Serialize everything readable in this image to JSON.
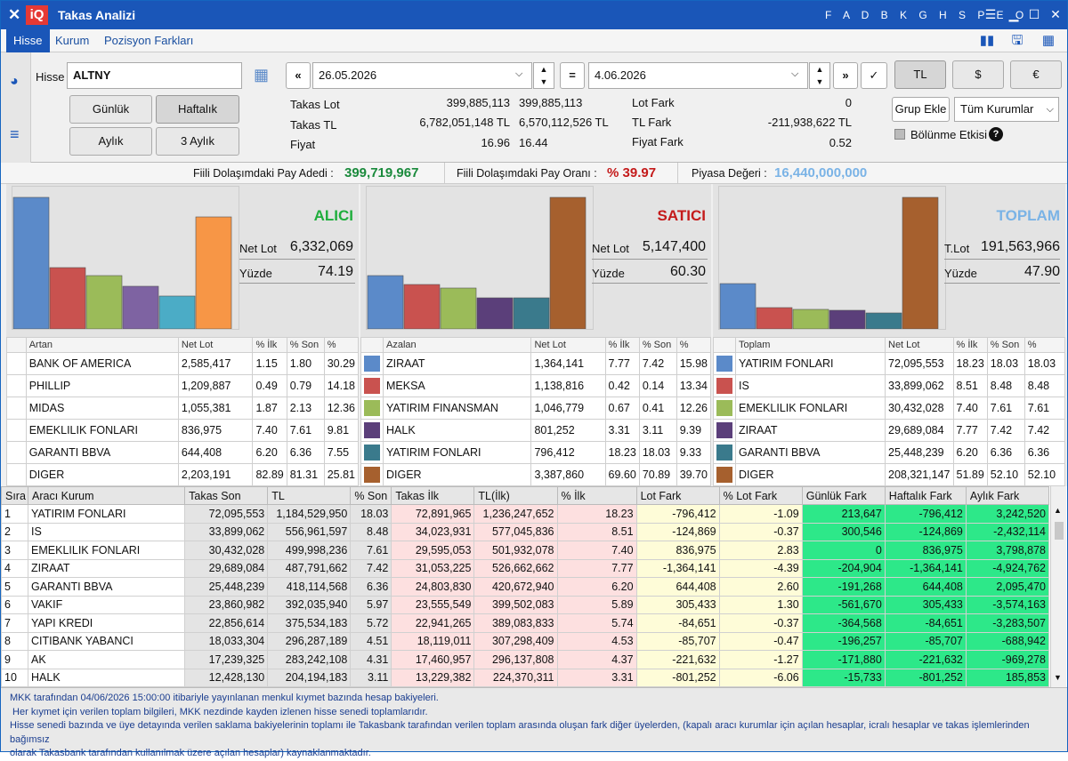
{
  "window": {
    "title": "Takas Analizi",
    "letter_menu": "F A D B K G H S P E O"
  },
  "tabs": [
    {
      "label": "Hisse"
    },
    {
      "label": "Kurum"
    },
    {
      "label": "Pozisyon Farkları"
    }
  ],
  "controls": {
    "hisse_label": "Hisse",
    "hisse_value": "ALTNY",
    "date_from": "26.05.2026",
    "date_to": "4.06.2026",
    "period_buttons": [
      "Günlük",
      "Haftalık",
      "Aylık",
      "3 Aylık"
    ],
    "currency_buttons": [
      "TL",
      "$",
      "€"
    ],
    "grup_ekle": "Grup Ekle",
    "kurum_select": "Tüm Kurumlar",
    "bolunme_label": "Bölünme Etkisi",
    "bolunme_checked": false
  },
  "summary": {
    "takas_lot": {
      "label": "Takas Lot",
      "v1": "399,885,113",
      "v2": "399,885,113"
    },
    "takas_tl": {
      "label": "Takas TL",
      "v1": "6,782,051,148 TL",
      "v2": "6,570,112,526 TL"
    },
    "fiyat": {
      "label": "Fiyat",
      "v1": "16.96",
      "v2": "16.44"
    },
    "lot_fark": {
      "label": "Lot Fark",
      "value": "0"
    },
    "tl_fark": {
      "label": "TL Fark",
      "value": "-211,938,622 TL"
    },
    "fiyat_fark": {
      "label": "Fiyat Fark",
      "value": "0.52"
    }
  },
  "stats": {
    "pay_adedi_label": "Fiili Dolaşımdaki Pay Adedi :",
    "pay_adedi": "399,719,967",
    "pay_orani_label": "Fiili Dolaşımdaki Pay Oranı :",
    "pay_orani": "% 39.97",
    "piyasa_label": "Piyasa Değeri :",
    "piyasa": "16,440,000,000"
  },
  "colors": {
    "blue": "#5b8ac9",
    "red": "#c9524f",
    "green": "#9bbb59",
    "purple": "#7e63a2",
    "teal": "#4bacc6",
    "orange": "#f79646",
    "brown": "#a6602e",
    "dteal": "#3a7a8c",
    "dpurple": "#5b3f7a",
    "alici": "#1fae3c",
    "satici": "#c41a1a",
    "toplam": "#7ab3e6"
  },
  "panels": [
    {
      "title": "ALICI",
      "k1": "Net Lot",
      "v1": "6,332,069",
      "k2": "Yüzde",
      "v2": "74.19",
      "chart_data": {
        "type": "bar",
        "values": [
          2585417,
          1209887,
          1055381,
          836975,
          644408,
          2203191
        ],
        "colors": [
          "#5b8ac9",
          "#c9524f",
          "#9bbb59",
          "#7e63a2",
          "#4bacc6",
          "#f79646"
        ]
      },
      "header": [
        "Artan",
        "Net Lot",
        "% İlk",
        "% Son",
        "%"
      ],
      "rows": [
        {
          "swatch": "",
          "name": "BANK OF AMERICA",
          "net": "2,585,417",
          "ilk": "1.15",
          "son": "1.80",
          "pct": "30.29"
        },
        {
          "swatch": "",
          "name": "PHILLIP",
          "net": "1,209,887",
          "ilk": "0.49",
          "son": "0.79",
          "pct": "14.18"
        },
        {
          "swatch": "",
          "name": "MIDAS",
          "net": "1,055,381",
          "ilk": "1.87",
          "son": "2.13",
          "pct": "12.36"
        },
        {
          "swatch": "",
          "name": "EMEKLILIK FONLARI",
          "net": "836,975",
          "ilk": "7.40",
          "son": "7.61",
          "pct": "9.81"
        },
        {
          "swatch": "",
          "name": "GARANTI BBVA",
          "net": "644,408",
          "ilk": "6.20",
          "son": "6.36",
          "pct": "7.55"
        },
        {
          "swatch": "",
          "name": "DIGER",
          "net": "2,203,191",
          "ilk": "82.89",
          "son": "81.31",
          "pct": "25.81"
        }
      ]
    },
    {
      "title": "SATICI",
      "k1": "Net Lot",
      "v1": "5,147,400",
      "k2": "Yüzde",
      "v2": "60.30",
      "chart_data": {
        "type": "bar",
        "values": [
          1364141,
          1138816,
          1046779,
          801252,
          796412,
          3387860
        ],
        "colors": [
          "#5b8ac9",
          "#c9524f",
          "#9bbb59",
          "#5b3f7a",
          "#3a7a8c",
          "#a6602e"
        ]
      },
      "header": [
        "Azalan",
        "Net Lot",
        "% İlk",
        "% Son",
        "%"
      ],
      "rows": [
        {
          "swatch": "#5b8ac9",
          "name": "ZIRAAT",
          "net": "1,364,141",
          "ilk": "7.77",
          "son": "7.42",
          "pct": "15.98"
        },
        {
          "swatch": "#c9524f",
          "name": "MEKSA",
          "net": "1,138,816",
          "ilk": "0.42",
          "son": "0.14",
          "pct": "13.34"
        },
        {
          "swatch": "#9bbb59",
          "name": "YATIRIM FINANSMAN",
          "net": "1,046,779",
          "ilk": "0.67",
          "son": "0.41",
          "pct": "12.26"
        },
        {
          "swatch": "#5b3f7a",
          "name": "HALK",
          "net": "801,252",
          "ilk": "3.31",
          "son": "3.11",
          "pct": "9.39"
        },
        {
          "swatch": "#3a7a8c",
          "name": "YATIRIM FONLARI",
          "net": "796,412",
          "ilk": "18.23",
          "son": "18.03",
          "pct": "9.33"
        },
        {
          "swatch": "#a6602e",
          "name": "DIGER",
          "net": "3,387,860",
          "ilk": "69.60",
          "son": "70.89",
          "pct": "39.70"
        }
      ]
    },
    {
      "title": "TOPLAM",
      "k1": "T.Lot",
      "v1": "191,563,966",
      "k2": "Yüzde",
      "v2": "47.90",
      "chart_data": {
        "type": "bar",
        "values": [
          72095553,
          33899062,
          30432028,
          29689084,
          25448239,
          208321147
        ],
        "colors": [
          "#5b8ac9",
          "#c9524f",
          "#9bbb59",
          "#5b3f7a",
          "#3a7a8c",
          "#a6602e"
        ]
      },
      "header": [
        "Toplam",
        "Net Lot",
        "% İlk",
        "% Son",
        "%"
      ],
      "rows": [
        {
          "swatch": "#5b8ac9",
          "name": "YATIRIM FONLARI",
          "net": "72,095,553",
          "ilk": "18.23",
          "son": "18.03",
          "pct": "18.03"
        },
        {
          "swatch": "#c9524f",
          "name": "IS",
          "net": "33,899,062",
          "ilk": "8.51",
          "son": "8.48",
          "pct": "8.48"
        },
        {
          "swatch": "#9bbb59",
          "name": "EMEKLILIK FONLARI",
          "net": "30,432,028",
          "ilk": "7.40",
          "son": "7.61",
          "pct": "7.61"
        },
        {
          "swatch": "#5b3f7a",
          "name": "ZIRAAT",
          "net": "29,689,084",
          "ilk": "7.77",
          "son": "7.42",
          "pct": "7.42"
        },
        {
          "swatch": "#3a7a8c",
          "name": "GARANTI BBVA",
          "net": "25,448,239",
          "ilk": "6.20",
          "son": "6.36",
          "pct": "6.36"
        },
        {
          "swatch": "#a6602e",
          "name": "DIGER",
          "net": "208,321,147",
          "ilk": "51.89",
          "son": "52.10",
          "pct": "52.10"
        }
      ]
    }
  ],
  "main_table": {
    "headers": [
      "Sıra",
      "Aracı Kurum",
      "Takas Son",
      "TL",
      "% Son",
      "Takas İlk",
      "TL(İlk)",
      "% İlk",
      "Lot Fark",
      "% Lot Fark",
      "Günlük Fark",
      "Haftalık Fark",
      "Aylık Fark"
    ],
    "rows": [
      [
        "1",
        "YATIRIM FONLARI",
        "72,095,553",
        "1,184,529,950",
        "18.03",
        "72,891,965",
        "1,236,247,652",
        "18.23",
        "-796,412",
        "-1.09",
        "213,647",
        "-796,412",
        "3,242,520"
      ],
      [
        "2",
        "IS",
        "33,899,062",
        "556,961,597",
        "8.48",
        "34,023,931",
        "577,045,836",
        "8.51",
        "-124,869",
        "-0.37",
        "300,546",
        "-124,869",
        "-2,432,114"
      ],
      [
        "3",
        "EMEKLILIK FONLARI",
        "30,432,028",
        "499,998,236",
        "7.61",
        "29,595,053",
        "501,932,078",
        "7.40",
        "836,975",
        "2.83",
        "0",
        "836,975",
        "3,798,878"
      ],
      [
        "4",
        "ZIRAAT",
        "29,689,084",
        "487,791,662",
        "7.42",
        "31,053,225",
        "526,662,662",
        "7.77",
        "-1,364,141",
        "-4.39",
        "-204,904",
        "-1,364,141",
        "-4,924,762"
      ],
      [
        "5",
        "GARANTI BBVA",
        "25,448,239",
        "418,114,568",
        "6.36",
        "24,803,830",
        "420,672,940",
        "6.20",
        "644,408",
        "2.60",
        "-191,268",
        "644,408",
        "2,095,470"
      ],
      [
        "6",
        "VAKIF",
        "23,860,982",
        "392,035,940",
        "5.97",
        "23,555,549",
        "399,502,083",
        "5.89",
        "305,433",
        "1.30",
        "-561,670",
        "305,433",
        "-3,574,163"
      ],
      [
        "7",
        "YAPI KREDI",
        "22,856,614",
        "375,534,183",
        "5.72",
        "22,941,265",
        "389,083,833",
        "5.74",
        "-84,651",
        "-0.37",
        "-364,568",
        "-84,651",
        "-3,283,507"
      ],
      [
        "8",
        "CITIBANK YABANCI",
        "18,033,304",
        "296,287,189",
        "4.51",
        "18,119,011",
        "307,298,409",
        "4.53",
        "-85,707",
        "-0.47",
        "-196,257",
        "-85,707",
        "-688,942"
      ],
      [
        "9",
        "AK",
        "17,239,325",
        "283,242,108",
        "4.31",
        "17,460,957",
        "296,137,808",
        "4.37",
        "-221,632",
        "-1.27",
        "-171,880",
        "-221,632",
        "-969,278"
      ],
      [
        "10",
        "HALK",
        "12,428,130",
        "204,194,183",
        "3.11",
        "13,229,382",
        "224,370,311",
        "3.31",
        "-801,252",
        "-6.06",
        "-15,733",
        "-801,252",
        "185,853"
      ]
    ]
  },
  "footer": [
    "MKK tarafından 04/06/2026 15:00:00 itibariyle yayınlanan menkul kıymet bazında hesap bakiyeleri.",
    " Her kıymet için verilen toplam bilgileri, MKK nezdinde kayden izlenen hisse senedi toplamlarıdır.",
    "Hisse senedi bazında ve üye detayında verilen saklama bakiyelerinin toplamı ile Takasbank tarafından verilen toplam arasında oluşan fark diğer üyelerden, (kapalı aracı kurumlar için açılan hesaplar, icralı hesaplar ve takas işlemlerinden bağımsız",
    "olarak Takasbank tarafından kullanılmak üzere açılan hesaplar) kaynaklanmaktadır."
  ]
}
